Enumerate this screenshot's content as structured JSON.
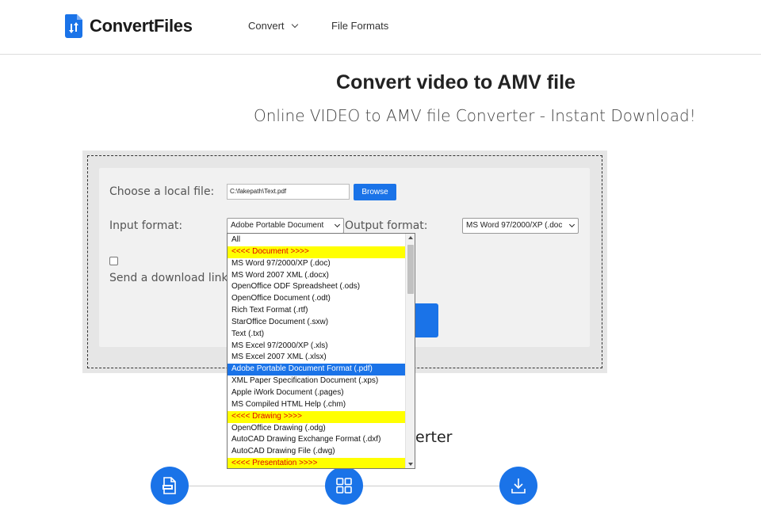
{
  "header": {
    "logo_text": "ConvertFiles",
    "nav": {
      "convert_label": "Convert",
      "formats_label": "File Formats"
    }
  },
  "page": {
    "title": "Convert video to AMV file",
    "subtitle": "Online VIDEO to AMV file Converter - Instant Download!",
    "section_heading_partial": "erter"
  },
  "form": {
    "choose_label": "Choose a local file:",
    "file_value": "C:\\fakepath\\Text.pdf",
    "browse_label": "Browse",
    "input_format_label": "Input format:",
    "input_format_value": "Adobe Portable Document",
    "output_format_label": "Output format:",
    "output_format_value": "MS Word 97/2000/XP (.doc",
    "send_label": "Send a download link to",
    "send_checked": false
  },
  "dropdown": {
    "options": [
      {
        "label": "All",
        "type": "option"
      },
      {
        "label": "<<<< Document >>>>",
        "type": "group"
      },
      {
        "label": "MS Word 97/2000/XP (.doc)",
        "type": "option"
      },
      {
        "label": "MS Word 2007 XML (.docx)",
        "type": "option"
      },
      {
        "label": "OpenOffice ODF Spreadsheet (.ods)",
        "type": "option"
      },
      {
        "label": "OpenOffice Document (.odt)",
        "type": "option"
      },
      {
        "label": "Rich Text Format (.rtf)",
        "type": "option"
      },
      {
        "label": "StarOffice Document (.sxw)",
        "type": "option"
      },
      {
        "label": "Text (.txt)",
        "type": "option"
      },
      {
        "label": "MS Excel 97/2000/XP (.xls)",
        "type": "option"
      },
      {
        "label": "MS Excel 2007 XML (.xlsx)",
        "type": "option"
      },
      {
        "label": "Adobe Portable Document Format (.pdf)",
        "type": "selected"
      },
      {
        "label": "XML Paper Specification Document (.xps)",
        "type": "option"
      },
      {
        "label": "Apple iWork Document (.pages)",
        "type": "option"
      },
      {
        "label": "MS Compiled HTML Help (.chm)",
        "type": "option"
      },
      {
        "label": "<<<< Drawing >>>>",
        "type": "group"
      },
      {
        "label": "OpenOffice Drawing (.odg)",
        "type": "option"
      },
      {
        "label": "AutoCAD Drawing Exchange Format (.dxf)",
        "type": "option"
      },
      {
        "label": "AutoCAD Drawing File (.dwg)",
        "type": "option"
      },
      {
        "label": "<<<< Presentation >>>>",
        "type": "group"
      }
    ]
  },
  "steps": [
    {
      "icon": "file-icon"
    },
    {
      "icon": "grid-icon"
    },
    {
      "icon": "download-icon"
    }
  ],
  "colors": {
    "accent": "#1a73e8",
    "group_bg": "#ffff00",
    "group_text": "#e00000"
  }
}
